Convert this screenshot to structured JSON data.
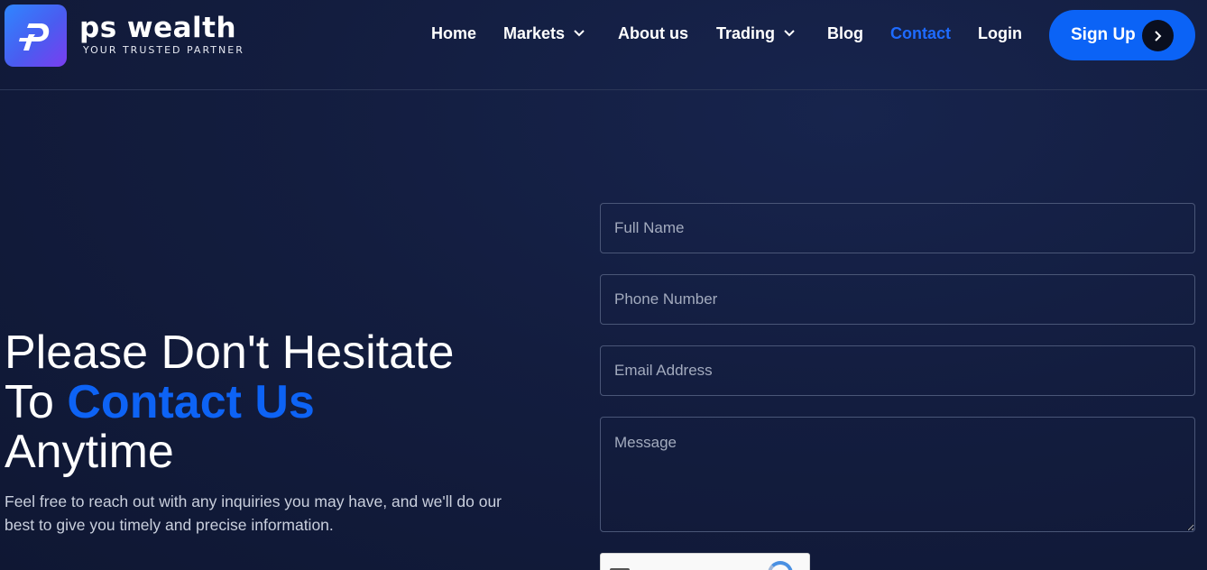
{
  "brand": {
    "name": "ps wealth",
    "tagline": "YOUR TRUSTED PARTNER"
  },
  "nav": {
    "items": [
      {
        "label": "Home",
        "has_dropdown": false,
        "active": false
      },
      {
        "label": "Markets",
        "has_dropdown": true,
        "active": false
      },
      {
        "label": "About us",
        "has_dropdown": false,
        "active": false
      },
      {
        "label": "Trading",
        "has_dropdown": true,
        "active": false
      },
      {
        "label": "Blog",
        "has_dropdown": false,
        "active": false
      },
      {
        "label": "Contact",
        "has_dropdown": false,
        "active": true
      },
      {
        "label": "Login",
        "has_dropdown": false,
        "active": false
      }
    ],
    "signup_label": "Sign Up"
  },
  "hero": {
    "title_line1": "Please Don't Hesitate",
    "title_line2_prefix": "To ",
    "title_line2_accent": "Contact Us",
    "title_line3": "Anytime",
    "subtitle": "Feel free to reach out with any inquiries you may have, and we'll do our best to give you timely and precise information."
  },
  "form": {
    "full_name_placeholder": "Full Name",
    "phone_placeholder": "Phone Number",
    "email_placeholder": "Email Address",
    "message_placeholder": "Message"
  },
  "colors": {
    "accent": "#0d63f5",
    "background": "#131d3f",
    "signup_button": "#0b63f6"
  },
  "icons": [
    "logo-icon",
    "chevron-down-icon",
    "chevron-right-icon",
    "recaptcha-icon"
  ]
}
